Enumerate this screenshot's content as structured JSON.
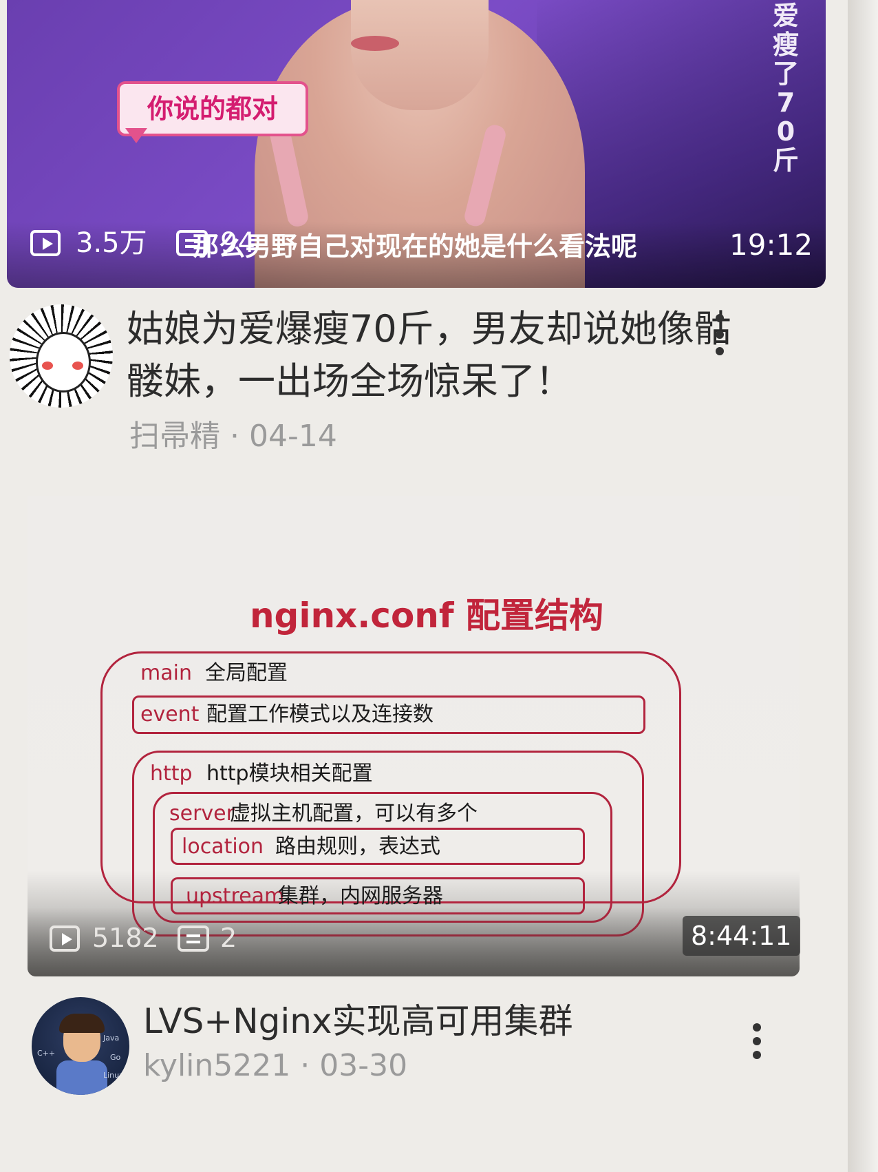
{
  "feed": {
    "videos": [
      {
        "thumbnail_sticker": "你说的都对",
        "thumbnail_vertical_text": "爱瘦了70斤",
        "thumbnail_subtitle": "那么男野自己对现在的她是什么看法呢",
        "plays": "3.5万",
        "danmaku": "94",
        "duration": "19:12",
        "title": "姑娘为爱爆瘦70斤，男友却说她像骷髅妹，一出场全场惊呆了！",
        "author": "扫帚精",
        "date": "04-14",
        "author_meta": "扫帚精 · 04-14"
      },
      {
        "slide": {
          "title": "nginx.conf 配置结构",
          "main_kw": "main",
          "main_desc": "全局配置",
          "event_kw": "event",
          "event_desc": "配置工作模式以及连接数",
          "http_kw": "http",
          "http_desc": "http模块相关配置",
          "server_kw": "server",
          "server_desc": "虚拟主机配置，可以有多个",
          "location_kw": "location",
          "location_desc": "路由规则，表达式",
          "upstream_kw": "upstream",
          "upstream_desc": "集群，内网服务器"
        },
        "plays": "5182",
        "danmaku": "2",
        "duration": "8:44:11",
        "title": "LVS+Nginx实现高可用集群",
        "author": "kylin5221",
        "date": "03-30",
        "author_meta": "kylin5221 · 03-30",
        "avatar_text": [
          "Java",
          "C++",
          "Go",
          "Linux"
        ]
      }
    ]
  },
  "icons": [
    "play-count-icon",
    "danmaku-icon",
    "more-options-icon"
  ],
  "colors": {
    "slide_accent": "#b2243e",
    "sticker_pink": "#d41d70",
    "text_primary": "#2c2c2c",
    "text_meta": "#9a9a9a"
  }
}
